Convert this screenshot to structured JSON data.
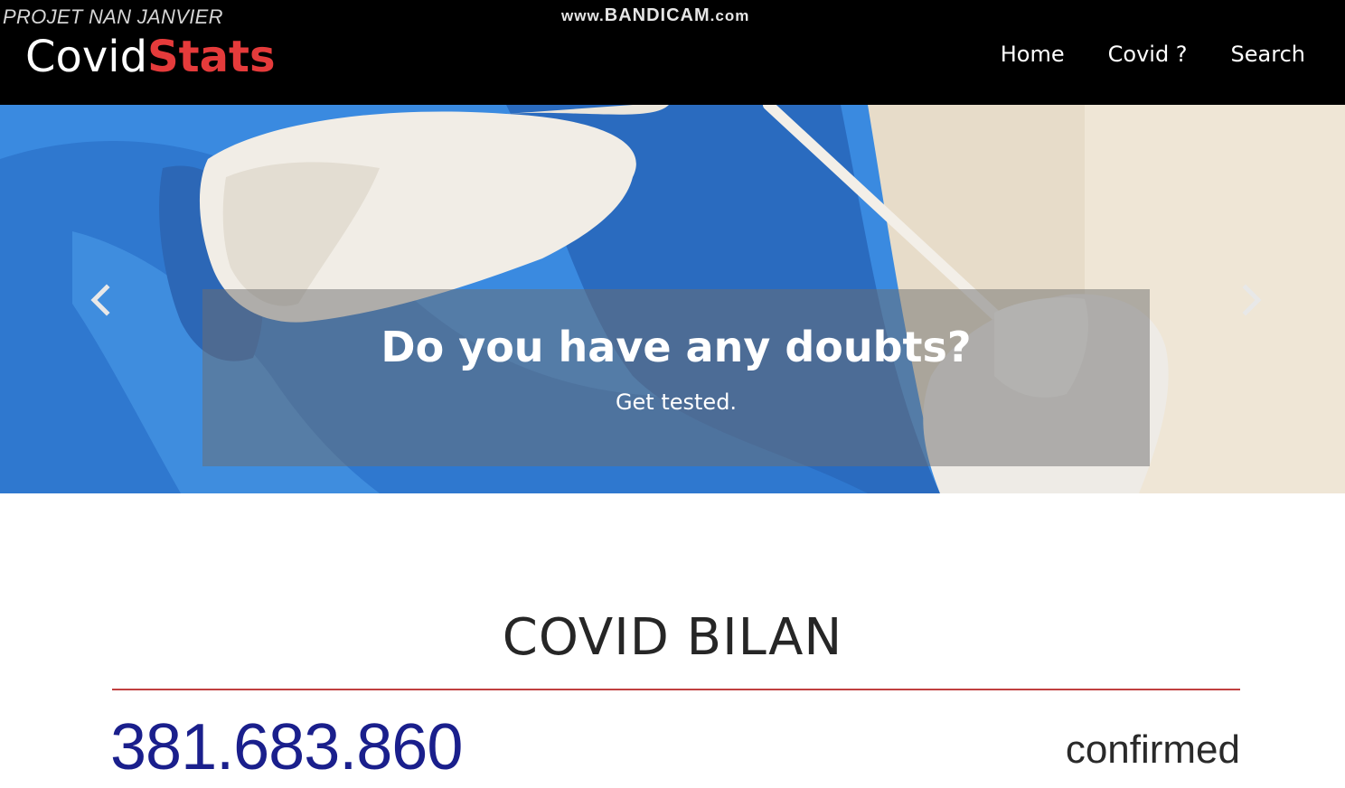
{
  "watermarks": {
    "project": "PROJET NAN JANVIER",
    "recorder_prefix": "www.",
    "recorder_main": "BANDICAM",
    "recorder_suffix": ".com"
  },
  "brand": {
    "part1": "Covid",
    "part2": "Stats",
    "accent_color": "#e53b3b"
  },
  "nav": {
    "items": [
      {
        "label": "Home"
      },
      {
        "label": "Covid ?"
      },
      {
        "label": "Search"
      }
    ]
  },
  "carousel": {
    "prev_icon": "chevron-left-icon",
    "next_icon": "chevron-right-icon",
    "caption_title": "Do you have any doubts?",
    "caption_subtitle": "Get tested."
  },
  "bilan": {
    "title": "COVID BILAN",
    "rule_color": "#c04040",
    "stats": [
      {
        "value": "381.683.860",
        "label": "confirmed",
        "value_color": "#1a1f8c"
      }
    ]
  }
}
